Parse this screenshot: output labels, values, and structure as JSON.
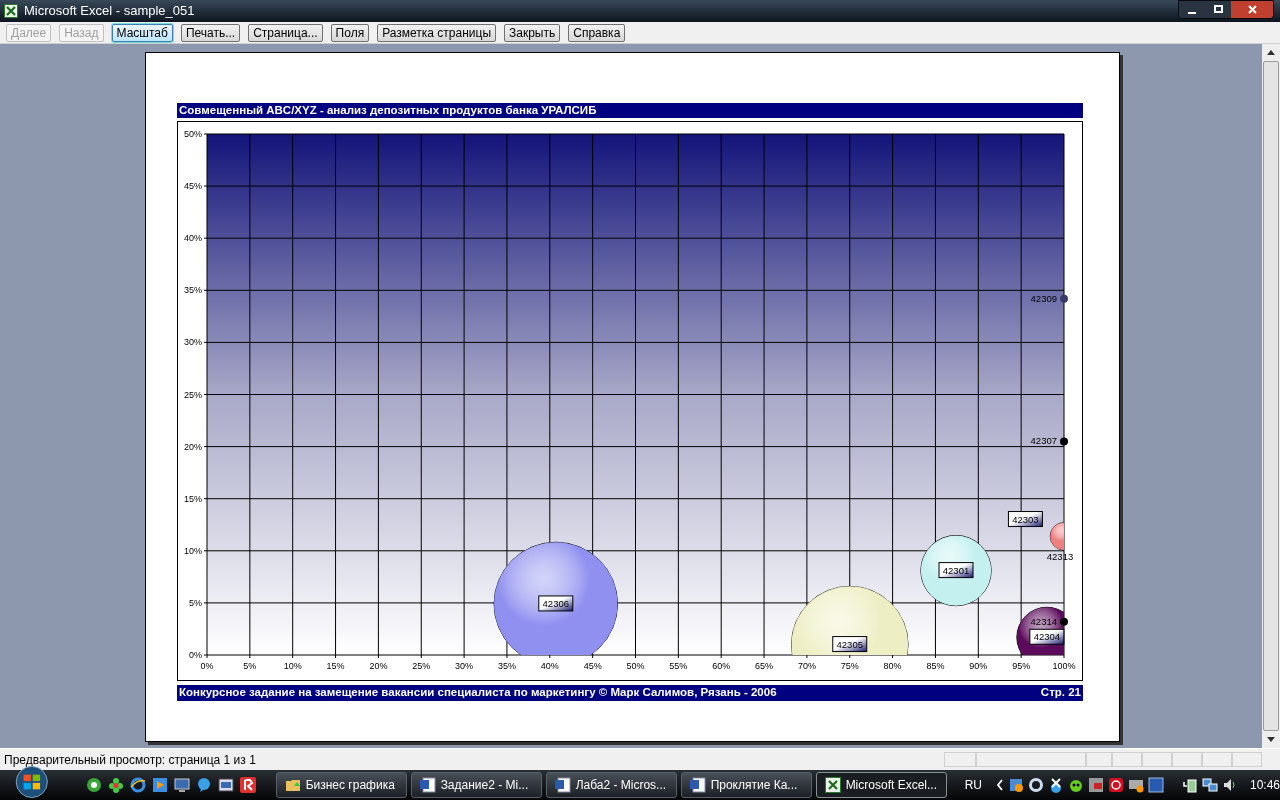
{
  "window": {
    "title": "Microsoft Excel - sample_051"
  },
  "toolbar": {
    "buttons": [
      {
        "label": "Далее",
        "disabled": true,
        "selected": false
      },
      {
        "label": "Назад",
        "disabled": true,
        "selected": false
      },
      {
        "label": "Масштаб",
        "disabled": false,
        "selected": true
      },
      {
        "label": "Печать...",
        "disabled": false,
        "selected": false
      },
      {
        "label": "Страница...",
        "disabled": false,
        "selected": false
      },
      {
        "label": "Поля",
        "disabled": false,
        "selected": false
      },
      {
        "label": "Разметка страницы",
        "disabled": false,
        "selected": false
      },
      {
        "label": "Закрыть",
        "disabled": false,
        "selected": false
      },
      {
        "label": "Справка",
        "disabled": false,
        "selected": false
      }
    ]
  },
  "page": {
    "header": "Совмещенный ABC/XYZ - анализ депозитных продуктов банка УРАЛСИБ",
    "chart_data": {
      "type": "scatter",
      "xlim": [
        0,
        100
      ],
      "ylim": [
        0,
        50
      ],
      "xticks": [
        {
          "value": 0,
          "label": "0%"
        },
        {
          "value": 5,
          "label": "5%"
        },
        {
          "value": 10,
          "label": "10%"
        },
        {
          "value": 15,
          "label": "15%"
        },
        {
          "value": 20,
          "label": "20%"
        },
        {
          "value": 25,
          "label": "25%"
        },
        {
          "value": 30,
          "label": "30%"
        },
        {
          "value": 35,
          "label": "35%"
        },
        {
          "value": 40,
          "label": "40%"
        },
        {
          "value": 45,
          "label": "45%"
        },
        {
          "value": 50,
          "label": "50%"
        },
        {
          "value": 55,
          "label": "55%"
        },
        {
          "value": 60,
          "label": "60%"
        },
        {
          "value": 65,
          "label": "65%"
        },
        {
          "value": 70,
          "label": "70%"
        },
        {
          "value": 75,
          "label": "75%"
        },
        {
          "value": 80,
          "label": "80%"
        },
        {
          "value": 85,
          "label": "85%"
        },
        {
          "value": 90,
          "label": "90%"
        },
        {
          "value": 95,
          "label": "95%"
        },
        {
          "value": 100,
          "label": "100%"
        }
      ],
      "yticks": [
        {
          "value": 0,
          "label": "0%"
        },
        {
          "value": 5,
          "label": "5%"
        },
        {
          "value": 10,
          "label": "10%"
        },
        {
          "value": 15,
          "label": "15%"
        },
        {
          "value": 20,
          "label": "20%"
        },
        {
          "value": 25,
          "label": "25%"
        },
        {
          "value": 30,
          "label": "30%"
        },
        {
          "value": 35,
          "label": "35%"
        },
        {
          "value": 40,
          "label": "40%"
        },
        {
          "value": 45,
          "label": "45%"
        },
        {
          "value": 50,
          "label": "50%"
        }
      ],
      "series": [
        {
          "name": "42306",
          "color": "#9090f0",
          "x": [
            40.7
          ],
          "values": [
            4.9
          ]
        },
        {
          "name": "42305",
          "color": "#eeeec4",
          "x": [
            75
          ],
          "values": [
            1
          ]
        },
        {
          "name": "42301",
          "color": "#c4f0f0",
          "x": [
            87.4
          ],
          "values": [
            8.1
          ]
        },
        {
          "name": "42304",
          "color": "#5c0a5c",
          "x": [
            98
          ],
          "values": [
            1.7
          ]
        },
        {
          "name": "42303",
          "x": [
            95.5
          ],
          "values": [
            13
          ]
        },
        {
          "name": "42313",
          "color": "#f08080",
          "x": [
            100
          ],
          "values": [
            11.4
          ]
        },
        {
          "name": "42307",
          "x": [
            100
          ],
          "values": [
            20.5
          ]
        },
        {
          "name": "42309",
          "color": "#3a3a6a",
          "x": [
            100
          ],
          "values": [
            34.2
          ]
        },
        {
          "name": "42314",
          "x": [
            100
          ],
          "values": [
            3.2
          ]
        }
      ],
      "grid": true
    },
    "footer_left": "Конкурсное задание на замещение вакансии специалиста по маркетингу © Марк Салимов, Рязань - 2006",
    "footer_right": "Стр. 21"
  },
  "status_bar": {
    "text": "Предварительный просмотр: страница 1 из 1"
  },
  "taskbar": {
    "items": [
      {
        "label": "Бизнес графика",
        "kind": "folder",
        "active": false
      },
      {
        "label": "Задание2 - Mi...",
        "kind": "word",
        "active": false
      },
      {
        "label": "Лаба2 - Micros...",
        "kind": "word",
        "active": false
      },
      {
        "label": "Проклятие Ка...",
        "kind": "word",
        "active": false
      },
      {
        "label": "Microsoft Excel...",
        "kind": "excel",
        "active": true
      }
    ],
    "language": "RU",
    "clock": "10:46"
  }
}
